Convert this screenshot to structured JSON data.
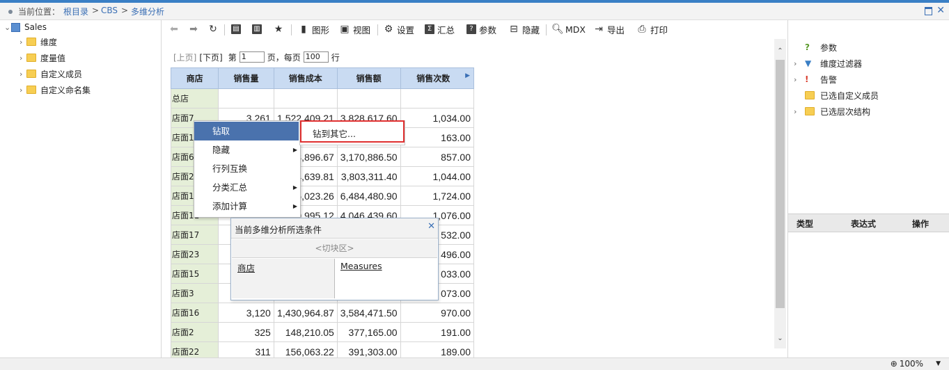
{
  "breadcrumb": {
    "label": "当前位置：",
    "root": "根目录",
    "sep": ">",
    "cbs": "CBS",
    "current": "多维分析"
  },
  "tree": {
    "root": "Sales",
    "items": [
      "维度",
      "度量值",
      "自定义成员",
      "自定义命名集"
    ]
  },
  "toolbar": {
    "chart": "图形",
    "view": "视图",
    "settings": "设置",
    "summary": "汇总",
    "params": "参数",
    "hide": "隐藏",
    "mdx": "MDX",
    "export": "导出",
    "print": "打印"
  },
  "pager": {
    "prev": "[上页]",
    "next": "[下页]",
    "page_prefix": "第",
    "page_value": "1",
    "page_suffix": "页，每页",
    "per_page": "100",
    "row_suffix": "行"
  },
  "grid": {
    "headers": [
      "商店",
      "销售量",
      "销售成本",
      "销售额",
      "销售次数"
    ],
    "rows": [
      {
        "store": "总店",
        "qty": "",
        "cost": "",
        "amount": "",
        "count": ""
      },
      {
        "store": "店面7",
        "qty": "3,261",
        "cost": "1,522,409.21",
        "amount": "3,828,617.60",
        "count": "1,034.00"
      },
      {
        "store": "店面1",
        "qty": "",
        "cost": "",
        "amount": "",
        "count": "163.00"
      },
      {
        "store": "店面6",
        "qty": "",
        "cost": "3,896.67",
        "amount": "3,170,886.50",
        "count": "857.00"
      },
      {
        "store": "店面2",
        "qty": "",
        "cost": "4,639.81",
        "amount": "3,803,311.40",
        "count": "1,044.00"
      },
      {
        "store": "店面1",
        "qty": "",
        "cost": "5,023.26",
        "amount": "6,484,480.90",
        "count": "1,724.00"
      },
      {
        "store": "店面11",
        "qty": "",
        "cost": "1,610,995.12",
        "amount": "4,046,439.60",
        "count": "1,076.00"
      },
      {
        "store": "店面17",
        "qty": "",
        "cost": "",
        "amount": "",
        "count": "532.00"
      },
      {
        "store": "店面23",
        "qty": "",
        "cost": "",
        "amount": "",
        "count": "496.00"
      },
      {
        "store": "店面15",
        "qty": "",
        "cost": "",
        "amount": "",
        "count": "033.00"
      },
      {
        "store": "店面3",
        "qty": "",
        "cost": "",
        "amount": "",
        "count": "073.00"
      },
      {
        "store": "店面16",
        "qty": "3,120",
        "cost": "1,430,964.87",
        "amount": "3,584,471.50",
        "count": "970.00"
      },
      {
        "store": "店面2",
        "qty": "325",
        "cost": "148,210.05",
        "amount": "377,165.00",
        "count": "191.00"
      },
      {
        "store": "店面22",
        "qty": "311",
        "cost": "156,063.22",
        "amount": "391,303.00",
        "count": "189.00"
      }
    ]
  },
  "context_menu": {
    "items": [
      "钻取",
      "隐藏",
      "行列互换",
      "分类汇总",
      "添加计算"
    ],
    "submenu": "钻到其它..."
  },
  "condition_dialog": {
    "title": "当前多维分析所选条件",
    "slice": "<切块区>",
    "rows": "商店",
    "columns": "Measures"
  },
  "right_panel": {
    "items": [
      "参数",
      "维度过滤器",
      "告警",
      "已选自定义成员",
      "已选层次结构"
    ],
    "table_headers": [
      "类型",
      "表达式",
      "操作"
    ]
  },
  "status": {
    "zoom": "100%"
  }
}
